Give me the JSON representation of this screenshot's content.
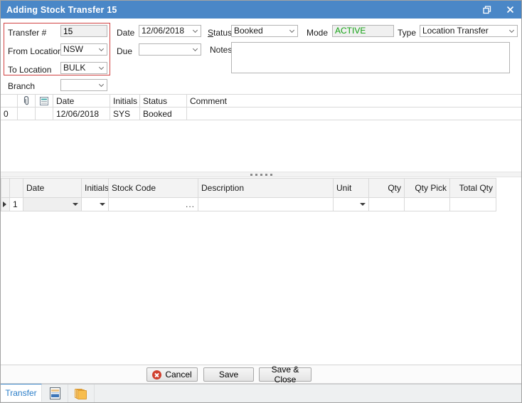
{
  "window": {
    "title": "Adding Stock Transfer 15",
    "titlebar_color": "#4a87c7"
  },
  "form": {
    "transfer_label": "Transfer #",
    "transfer_value": "15",
    "date_label": "Date",
    "date_value": "12/06/2018",
    "status_label_mnemonic": "S",
    "status_label_rest": "tatus",
    "status_value": "Booked",
    "mode_label": "Mode",
    "mode_value": "ACTIVE",
    "mode_color": "#12a112",
    "type_label": "Type",
    "type_value": "Location Transfer",
    "from_label": "From Location",
    "from_value": "NSW",
    "due_label": "Due",
    "due_value": "",
    "notes_label": "Notes",
    "notes_value": "",
    "to_label": "To Location",
    "to_value": "BULK",
    "branch_label": "Branch",
    "branch_value": "",
    "highlight_color": "#d04242"
  },
  "status_grid": {
    "header": {
      "date": "Date",
      "initials": "Initials",
      "status": "Status",
      "comment": "Comment"
    },
    "icon_columns": [
      "attachment-icon",
      "note-icon"
    ],
    "row": {
      "num": "0",
      "date": "12/06/2018",
      "initials": "SYS",
      "status": "Booked",
      "comment": ""
    }
  },
  "lines_grid": {
    "header": {
      "date": "Date",
      "initials": "Initials",
      "stock_code": "Stock Code",
      "description": "Description",
      "unit": "Unit",
      "qty": "Qty",
      "qty_pick": "Qty Pick",
      "total_qty": "Total Qty"
    },
    "row": {
      "num": "1",
      "date": "",
      "initials": "",
      "stock_code": "",
      "stock_code_button": "...",
      "description": "",
      "unit": "",
      "qty": "",
      "qty_pick": "",
      "total_qty": ""
    }
  },
  "footer": {
    "cancel_label": "Cancel",
    "save_label": "Save",
    "save_close_label": "Save & Close"
  },
  "tabs": {
    "transfer_label": "Transfer",
    "active_color": "#2a7dc8"
  }
}
